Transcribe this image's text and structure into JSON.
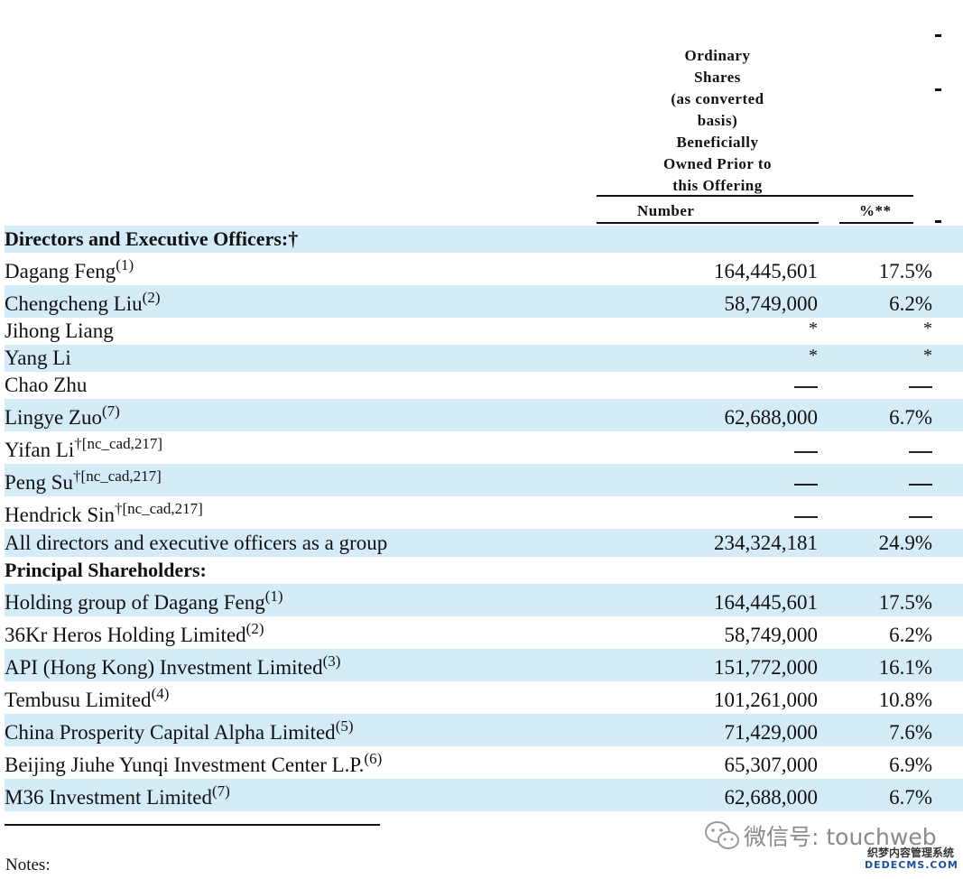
{
  "header": {
    "lines": [
      "Ordinary",
      "Shares",
      "(as converted",
      "basis)",
      "Beneficially",
      "Owned Prior to",
      "this Offering"
    ],
    "col_number": "Number",
    "col_pct": "%**"
  },
  "sections": {
    "directors": {
      "title": "Directors and Executive Officers:†"
    },
    "principal": {
      "title": "Principal Shareholders:"
    }
  },
  "rows": [
    {
      "name": "Dagang Feng",
      "sup": "(1)",
      "number": "164,445,601",
      "pct": "17.5%"
    },
    {
      "name": "Chengcheng Liu",
      "sup": "(2)",
      "number": "58,749,000",
      "pct": "6.2%"
    },
    {
      "name": "Jihong Liang",
      "sup": "",
      "number": "*",
      "pct": "*"
    },
    {
      "name": "Yang Li",
      "sup": "",
      "number": "*",
      "pct": "*"
    },
    {
      "name": "Chao Zhu",
      "sup": "",
      "number": "—",
      "pct": "—"
    },
    {
      "name": "Lingye Zuo",
      "sup": "(7)",
      "number": "62,688,000",
      "pct": "6.7%"
    },
    {
      "name": "Yifan Li",
      "sup": "†[nc_cad,217]",
      "number": "—",
      "pct": "—"
    },
    {
      "name": "Peng Su",
      "sup": "†[nc_cad,217]",
      "number": "—",
      "pct": "—"
    },
    {
      "name": "Hendrick Sin",
      "sup": "†[nc_cad,217]",
      "number": "—",
      "pct": "—"
    },
    {
      "name": "All directors and executive officers as a group",
      "sup": "",
      "number": "234,324,181",
      "pct": "24.9%"
    },
    {
      "name": "Holding group of Dagang Feng",
      "sup": "(1)",
      "number": "164,445,601",
      "pct": "17.5%"
    },
    {
      "name": "36Kr Heros Holding Limited",
      "sup": "(2)",
      "number": "58,749,000",
      "pct": "6.2%"
    },
    {
      "name": "API (Hong Kong) Investment Limited",
      "sup": "(3)",
      "number": "151,772,000",
      "pct": "16.1%"
    },
    {
      "name": "Tembusu Limited",
      "sup": "(4)",
      "number": "101,261,000",
      "pct": "10.8%"
    },
    {
      "name": "China Prosperity Capital Alpha Limited",
      "sup": "(5)",
      "number": "71,429,000",
      "pct": "7.6%"
    },
    {
      "name": "Beijing Jiuhe Yunqi Investment Center L.P.",
      "sup": "(6)",
      "number": "65,307,000",
      "pct": "6.9%"
    },
    {
      "name": "M36 Investment Limited",
      "sup": "(7)",
      "number": "62,688,000",
      "pct": "6.7%"
    }
  ],
  "notes": "Notes:",
  "watermark": {
    "text": "微信号: touchweb",
    "site_cn": "织梦内容管理系统",
    "site_en": "DEDECMS.COM",
    "icon": "wechat-icon"
  }
}
